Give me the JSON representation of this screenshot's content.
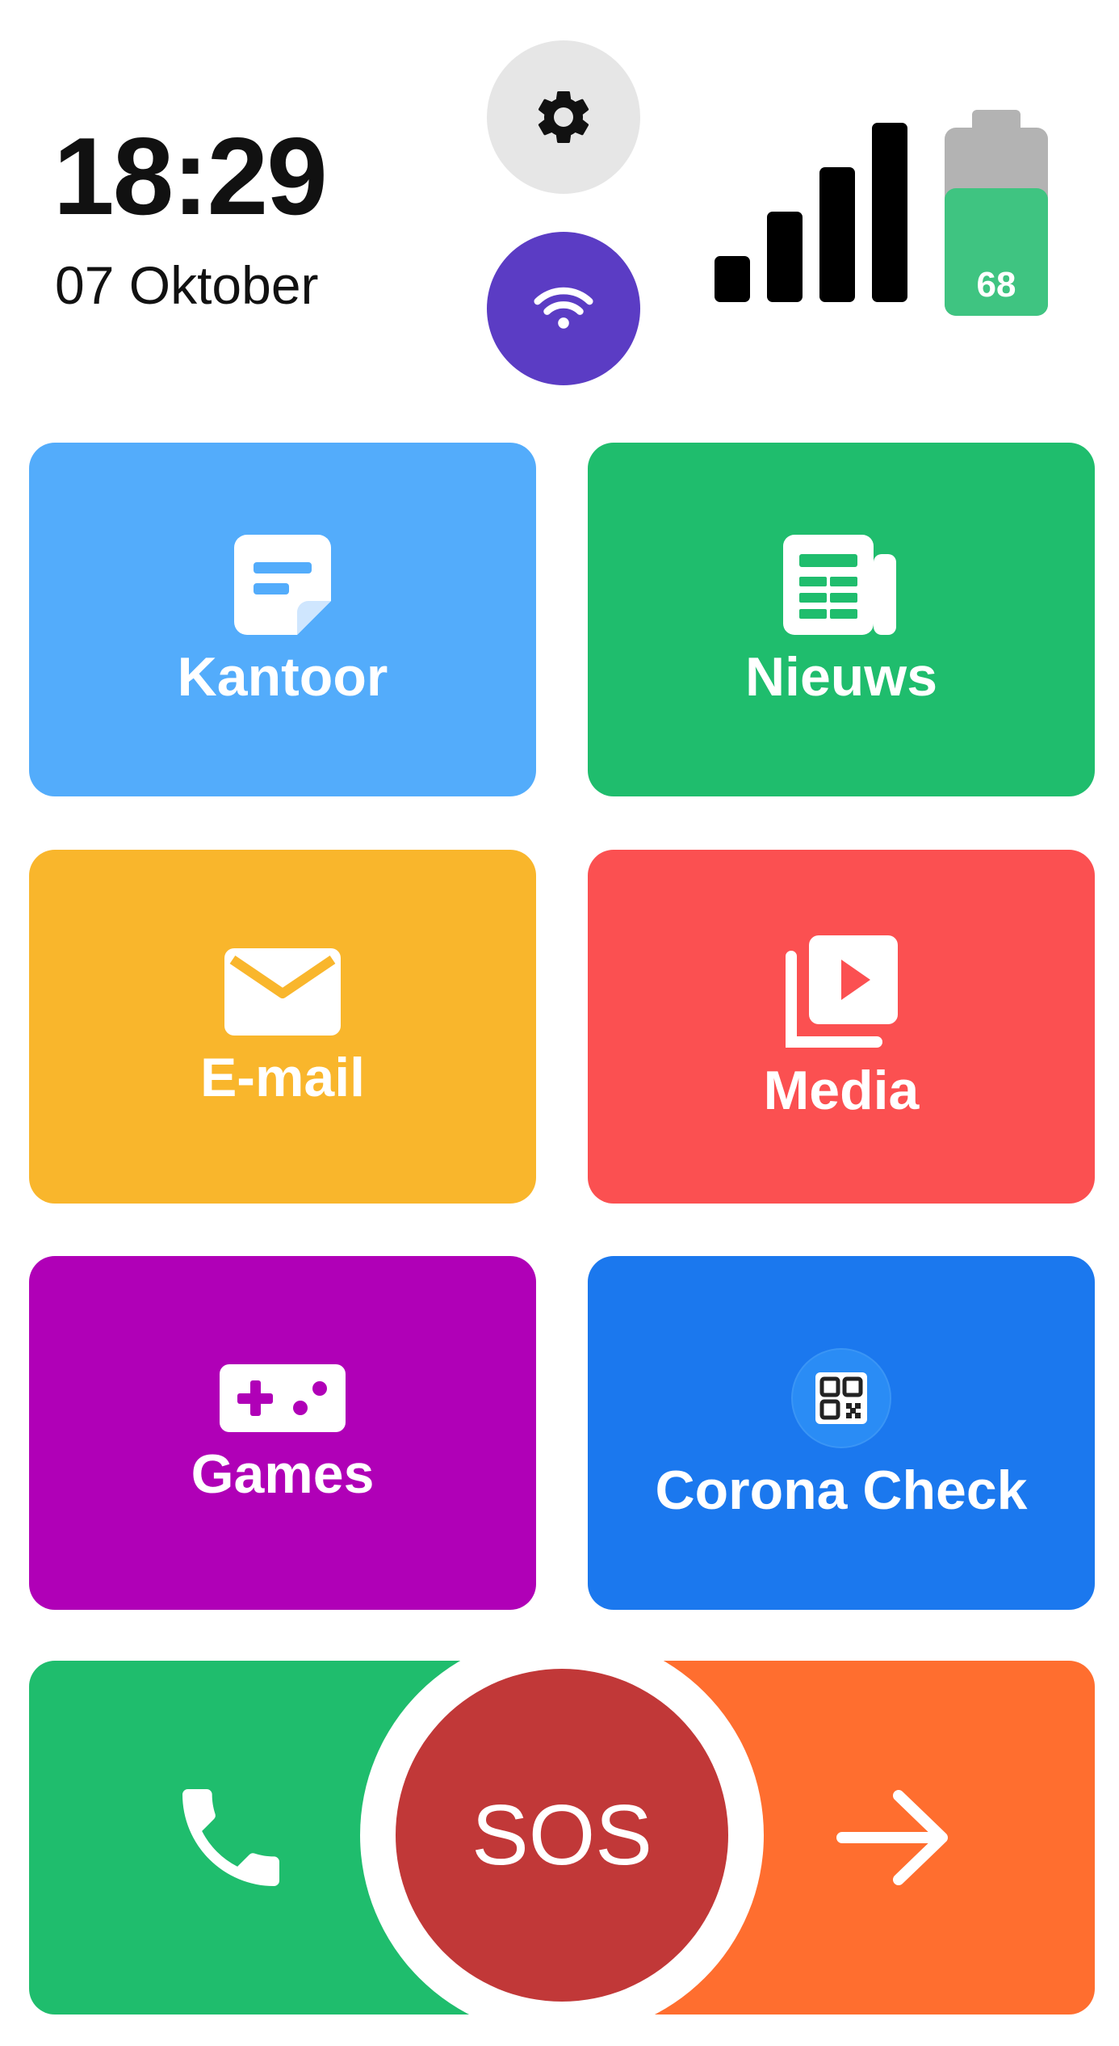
{
  "status": {
    "time": "18:29",
    "date": "07 Oktober",
    "battery_level": "68",
    "battery_fraction": 0.68,
    "signal_bars": 4
  },
  "tiles": [
    {
      "label": "Kantoor",
      "icon": "note-icon",
      "color": "#53acfb"
    },
    {
      "label": "Nieuws",
      "icon": "newspaper-icon",
      "color": "#1fbd6d"
    },
    {
      "label": "E-mail",
      "icon": "mail-icon",
      "color": "#f9b62c"
    },
    {
      "label": "Media",
      "icon": "video-library-icon",
      "color": "#fb5051"
    },
    {
      "label": "Games",
      "icon": "gamepad-icon",
      "color": "#b000b7"
    },
    {
      "label": "Corona Check",
      "icon": "qr-code-icon",
      "color": "#1b78ee"
    }
  ],
  "bottom_bar": {
    "call_icon": "phone-icon",
    "sos_label": "SOS",
    "next_icon": "arrow-right-icon",
    "colors": {
      "call": "#1fbd6d",
      "sos": "#c13838",
      "next": "#ff6e2f"
    }
  },
  "quick_buttons": {
    "settings_icon": "gear-icon",
    "wifi_icon": "wifi-icon",
    "wifi_color": "#5b3cc4"
  }
}
